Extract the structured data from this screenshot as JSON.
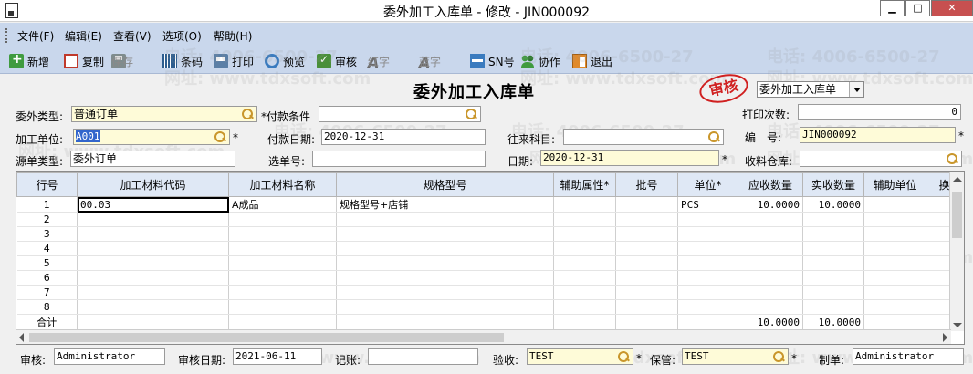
{
  "window": {
    "title": "委外加工入库单 - 修改 - JIN000092",
    "minimize": "▁",
    "maximize": "□",
    "close": "✕"
  },
  "menu": [
    "文件(F)",
    "编辑(E)",
    "查看(V)",
    "选项(O)",
    "帮助(H)"
  ],
  "toolbar": {
    "new": "新增",
    "copy": "复制",
    "save": "保存",
    "barcode": "条码",
    "print": "打印",
    "preview": "预览",
    "approve": "审核",
    "red": "红字",
    "blue": "蓝字",
    "sn": "SN号",
    "collab": "协作",
    "exit": "退出"
  },
  "doc": {
    "title": "委外加工入库单",
    "stamp": "审核",
    "type_select": "委外加工入库单"
  },
  "header": {
    "outsource_type_label": "委外类型:",
    "outsource_type": "普通订单",
    "payment_terms_label": "付款条件",
    "print_count_label": "打印次数:",
    "print_count": "0",
    "processor_label": "加工单位:",
    "processor": "A001",
    "payment_date_label": "付款日期:",
    "payment_date": "2020-12-31",
    "account_label": "往来科目:",
    "number_label": "编　号:",
    "number": "JIN000092",
    "source_type_label": "源单类型:",
    "source_type": "委外订单",
    "select_no_label": "选单号:",
    "date_label": "日期:",
    "date": "2020-12-31",
    "warehouse_label": "收料仓库:"
  },
  "grid": {
    "columns": [
      "行号",
      "加工材料代码",
      "加工材料名称",
      "规格型号",
      "辅助属性*",
      "批号",
      "单位*",
      "应收数量",
      "实收数量",
      "辅助单位",
      "换"
    ],
    "rows": [
      {
        "no": "1",
        "code": "00.03",
        "name": "A成品",
        "spec": "规格型号+店铺",
        "attr": "",
        "batch": "",
        "unit": "PCS",
        "due": "10.0000",
        "received": "10.0000",
        "aux": ""
      },
      {
        "no": "2",
        "code": "",
        "name": "",
        "spec": "",
        "attr": "",
        "batch": "",
        "unit": "",
        "due": "",
        "received": "",
        "aux": ""
      },
      {
        "no": "3",
        "code": "",
        "name": "",
        "spec": "",
        "attr": "",
        "batch": "",
        "unit": "",
        "due": "",
        "received": "",
        "aux": ""
      },
      {
        "no": "4",
        "code": "",
        "name": "",
        "spec": "",
        "attr": "",
        "batch": "",
        "unit": "",
        "due": "",
        "received": "",
        "aux": ""
      },
      {
        "no": "5",
        "code": "",
        "name": "",
        "spec": "",
        "attr": "",
        "batch": "",
        "unit": "",
        "due": "",
        "received": "",
        "aux": ""
      },
      {
        "no": "6",
        "code": "",
        "name": "",
        "spec": "",
        "attr": "",
        "batch": "",
        "unit": "",
        "due": "",
        "received": "",
        "aux": ""
      },
      {
        "no": "7",
        "code": "",
        "name": "",
        "spec": "",
        "attr": "",
        "batch": "",
        "unit": "",
        "due": "",
        "received": "",
        "aux": ""
      },
      {
        "no": "8",
        "code": "",
        "name": "",
        "spec": "",
        "attr": "",
        "batch": "",
        "unit": "",
        "due": "",
        "received": "",
        "aux": ""
      }
    ],
    "total_label": "合计",
    "total_due": "10.0000",
    "total_received": "10.0000"
  },
  "footer": {
    "reviewer_label": "审核:",
    "reviewer": "Administrator",
    "review_date_label": "审核日期:",
    "review_date": "2021-06-11",
    "bookkeeper_label": "记账:",
    "inspect_label": "验收:",
    "inspect": "TEST",
    "custodian_label": "保管:",
    "custodian": "TEST",
    "maker_label": "制单:",
    "maker": "Administrator"
  },
  "watermark": {
    "phone": "电话: 4006-6500-27",
    "site": "网址: www.tdxsoft.com"
  }
}
